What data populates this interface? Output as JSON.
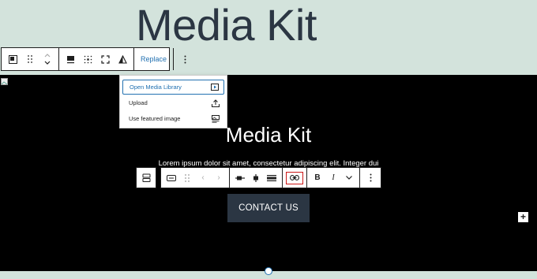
{
  "page": {
    "heading": "Media Kit"
  },
  "block_toolbar": {
    "replace_label": "Replace",
    "icons": [
      "cover-block-icon",
      "drag-handle-icon",
      "move-up-down-icon",
      "align-icon",
      "matrix-align-icon",
      "fullscreen-icon",
      "duotone-icon",
      "more-options-icon"
    ]
  },
  "media_menu": {
    "items": [
      {
        "label": "Open Media Library",
        "icon": "media-library-icon"
      },
      {
        "label": "Upload",
        "icon": "upload-icon"
      },
      {
        "label": "Use featured image",
        "icon": "featured-image-icon"
      }
    ]
  },
  "cover": {
    "title": "Media Kit",
    "text": "Lorem ipsum dolor sit amet, consectetur adipiscing elit. Integer dui",
    "button_label": "CONTACT US",
    "background": "#000000",
    "button_color": "#2b3643"
  },
  "button_toolbar": {
    "bold_label": "B",
    "italic_label": "I",
    "chevron_label": "⌄",
    "more_label": "⋮",
    "prev_label": "‹",
    "next_label": "›"
  },
  "colors": {
    "page_background": "#d3e3dc",
    "accent": "#2271b1",
    "link_highlight": "#cc1818",
    "heading": "#2b3643"
  }
}
